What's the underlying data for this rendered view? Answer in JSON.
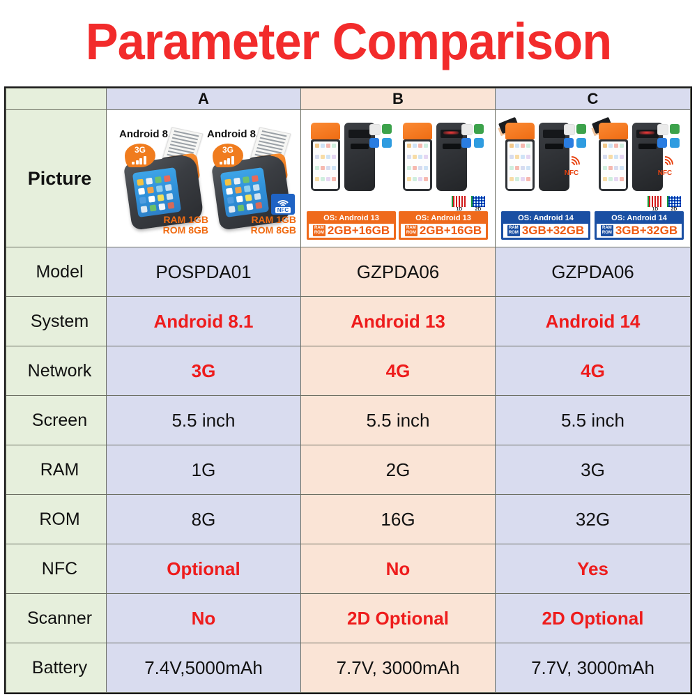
{
  "title": "Parameter Comparison",
  "accent_red": "#ee1c1c",
  "colors": {
    "title_red": "#f22b2b",
    "label_green": "#e6efdc",
    "col_a_blue": "#d9dcef",
    "col_b_peach": "#fae4d6",
    "col_c_blue": "#d9dcef",
    "orange": "#ef6a1c",
    "blue_banner": "#1a4fa3"
  },
  "table": {
    "headers": {
      "label": "",
      "a": "A",
      "b": "B",
      "c": "C"
    },
    "picture_row": {
      "label": "Picture",
      "a": {
        "devices": [
          {
            "os": "Android 8.1",
            "network_badge": "3G",
            "ram": "RAM 1GB",
            "rom": "ROM 8GB",
            "nfc_badge": ""
          },
          {
            "os": "Android 8.1",
            "network_badge": "3G",
            "ram": "RAM 1GB",
            "rom": "ROM 8GB",
            "nfc_badge": "NFC"
          }
        ]
      },
      "b": {
        "devices": [
          {
            "os": "OS: Android 13",
            "mem_tag_ram": "RAM",
            "mem_tag_rom": "ROM",
            "mem": "2GB+16GB",
            "codes": []
          },
          {
            "os": "OS: Android 13",
            "mem_tag_ram": "RAM",
            "mem_tag_rom": "ROM",
            "mem": "2GB+16GB",
            "codes": [
              "1D",
              "2D"
            ]
          }
        ]
      },
      "c": {
        "devices": [
          {
            "os": "OS: Android 14",
            "mem_tag_ram": "RAM",
            "mem_tag_rom": "ROM",
            "mem": "3GB+32GB",
            "nfc": "NFC",
            "codes": []
          },
          {
            "os": "OS: Android 14",
            "mem_tag_ram": "RAM",
            "mem_tag_rom": "ROM",
            "mem": "3GB+32GB",
            "nfc": "NFC",
            "codes": [
              "1D",
              "2D"
            ]
          }
        ]
      }
    },
    "rows": [
      {
        "label": "Model",
        "a": "POSPDA01",
        "b": "GZPDA06",
        "c": "GZPDA06",
        "red": false
      },
      {
        "label": "System",
        "a": "Android 8.1",
        "b": "Android 13",
        "c": "Android 14",
        "red": true
      },
      {
        "label": "Network",
        "a": "3G",
        "b": "4G",
        "c": "4G",
        "red": true
      },
      {
        "label": "Screen",
        "a": "5.5 inch",
        "b": "5.5 inch",
        "c": "5.5 inch",
        "red": false
      },
      {
        "label": "RAM",
        "a": "1G",
        "b": "2G",
        "c": "3G",
        "red": false
      },
      {
        "label": "ROM",
        "a": "8G",
        "b": "16G",
        "c": "32G",
        "red": false
      },
      {
        "label": "NFC",
        "a": "Optional",
        "b": "No",
        "c": "Yes",
        "red": true
      },
      {
        "label": "Scanner",
        "a": "No",
        "b": "2D Optional",
        "c": "2D Optional",
        "red": true
      },
      {
        "label": "Battery",
        "a": "7.4V,5000mAh",
        "b": "7.7V, 3000mAh",
        "c": "7.7V, 3000mAh",
        "red": false
      }
    ]
  }
}
